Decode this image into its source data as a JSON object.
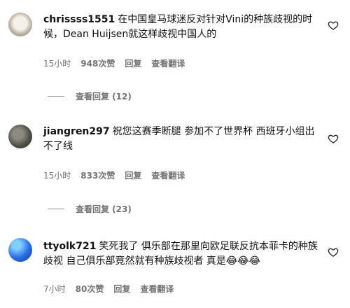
{
  "comments": [
    {
      "username": "chrissss1551",
      "text": "在中国皇马球迷反对针对Vini的种族歧视的时候，Dean Huijsen就这样歧视中国人的",
      "time": "15小时",
      "likes": "948次赞",
      "reply_label": "回复",
      "translate_label": "查看翻译",
      "view_replies": "查看回复 (12)"
    },
    {
      "username": "jiangren297",
      "text": "祝您这赛季断腿 参加不了世界杯 西班牙小组出不了线",
      "time": "15小时",
      "likes": "833次赞",
      "reply_label": "回复",
      "translate_label": "查看翻译",
      "view_replies": "查看回复 (23)"
    },
    {
      "username": "ttyolk721",
      "text": "笑死我了 俱乐部在那里向欧足联反抗本菲卡的种族歧视 自己俱乐部竟然就有种族歧视者 真是",
      "emojis": "😂😂😂",
      "time": "7小时",
      "likes": "80次赞",
      "reply_label": "回复",
      "translate_label": "查看翻译"
    }
  ]
}
